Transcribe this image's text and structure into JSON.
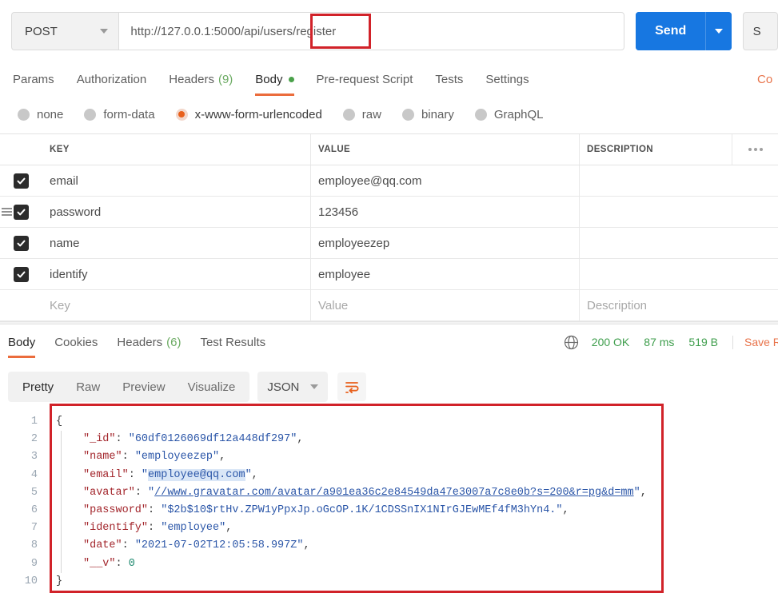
{
  "request": {
    "method": "POST",
    "url": "http://127.0.0.1:5000/api/users/register",
    "url_prefix": "http://127.0.0.1:5000/api/users/",
    "url_highlight": "register",
    "send_label": "Send",
    "save_label": "S",
    "accent_blue": "#1777e1",
    "annotation_color": "#d12229"
  },
  "request_tabs": [
    {
      "label": "Params",
      "count": "",
      "active": false
    },
    {
      "label": "Authorization",
      "count": "",
      "active": false
    },
    {
      "label": "Headers",
      "count": "(9)",
      "active": false
    },
    {
      "label": "Body",
      "count": "",
      "active": true,
      "dot": true
    },
    {
      "label": "Pre-request Script",
      "count": "",
      "active": false
    },
    {
      "label": "Tests",
      "count": "",
      "active": false
    },
    {
      "label": "Settings",
      "count": "",
      "active": false
    }
  ],
  "cookies_link": "Co",
  "body_types": [
    {
      "label": "none",
      "selected": false
    },
    {
      "label": "form-data",
      "selected": false
    },
    {
      "label": "x-www-form-urlencoded",
      "selected": true
    },
    {
      "label": "raw",
      "selected": false
    },
    {
      "label": "binary",
      "selected": false
    },
    {
      "label": "GraphQL",
      "selected": false
    }
  ],
  "table": {
    "headers": {
      "key": "KEY",
      "value": "VALUE",
      "description": "DESCRIPTION"
    },
    "rows": [
      {
        "checked": true,
        "key": "email",
        "value": "employee@qq.com",
        "description": ""
      },
      {
        "checked": true,
        "key": "password",
        "value": "123456",
        "description": "",
        "handle": true
      },
      {
        "checked": true,
        "key": "name",
        "value": "employeezep",
        "description": ""
      },
      {
        "checked": true,
        "key": "identify",
        "value": "employee",
        "description": ""
      }
    ],
    "placeholder": {
      "key": "Key",
      "value": "Value",
      "description": "Description"
    }
  },
  "response_tabs": [
    {
      "label": "Body",
      "count": "",
      "active": true
    },
    {
      "label": "Cookies",
      "count": "",
      "active": false
    },
    {
      "label": "Headers",
      "count": "(6)",
      "active": false
    },
    {
      "label": "Test Results",
      "count": "",
      "active": false
    }
  ],
  "response_meta": {
    "status": "200 OK",
    "time": "87 ms",
    "size": "519 B",
    "save_response": "Save R",
    "status_color": "#3f9e4d"
  },
  "viewer": {
    "modes": [
      {
        "label": "Pretty",
        "active": true
      },
      {
        "label": "Raw",
        "active": false
      },
      {
        "label": "Preview",
        "active": false
      },
      {
        "label": "Visualize",
        "active": false
      }
    ],
    "format": "JSON"
  },
  "json_response": {
    "line_numbers": [
      "1",
      "2",
      "3",
      "4",
      "5",
      "6",
      "7",
      "8",
      "9",
      "10"
    ],
    "fields": {
      "_id": "60df0126069df12a448df297",
      "name": "employeezep",
      "email": "employee@qq.com",
      "avatar": "//www.gravatar.com/avatar/a901ea36c2e84549da47e3007a7c8e0b?s=200&r=pg&d=mm",
      "password": "$2b$10$rtHv.ZPW1yPpxJp.oGcOP.1K/1CDSSnIX1NIrGJEwMEf4fM3hYn4.",
      "identify": "employee",
      "date": "2021-07-02T12:05:58.997Z",
      "__v": "0"
    },
    "keys": {
      "_id": "\"_id\"",
      "name": "\"name\"",
      "email": "\"email\"",
      "avatar": "\"avatar\"",
      "password": "\"password\"",
      "identify": "\"identify\"",
      "date": "\"date\"",
      "__v": "\"__v\""
    },
    "brace_open": "{",
    "brace_close": "}"
  }
}
